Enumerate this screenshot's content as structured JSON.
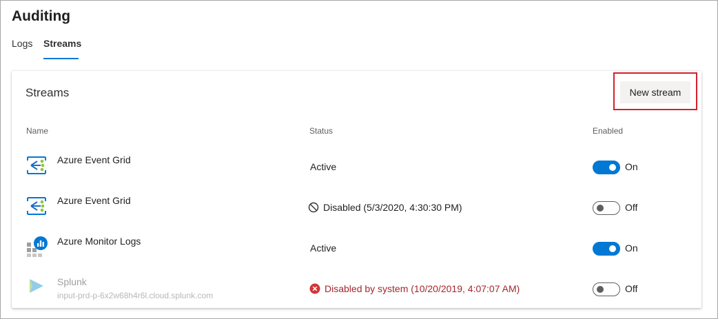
{
  "page": {
    "title": "Auditing"
  },
  "tabs": [
    {
      "label": "Logs",
      "selected": false
    },
    {
      "label": "Streams",
      "selected": true
    }
  ],
  "card": {
    "title": "Streams",
    "new_stream_label": "New stream"
  },
  "columns": {
    "name": "Name",
    "status": "Status",
    "enabled": "Enabled"
  },
  "rows": [
    {
      "icon": "event-grid-icon",
      "name": "Azure Event Grid",
      "subtitle": "",
      "status": "Active",
      "status_icon": "",
      "enabled": true,
      "toggle_label": "On"
    },
    {
      "icon": "event-grid-icon",
      "name": "Azure Event Grid",
      "subtitle": "",
      "status": "Disabled (5/3/2020, 4:30:30 PM)",
      "status_icon": "blocked-icon",
      "enabled": false,
      "toggle_label": "Off"
    },
    {
      "icon": "monitor-logs-icon",
      "name": "Azure Monitor Logs",
      "subtitle": "",
      "status": "Active",
      "status_icon": "",
      "enabled": true,
      "toggle_label": "On"
    },
    {
      "icon": "splunk-icon",
      "name": "Splunk",
      "subtitle": "input-prd-p-6x2w68h4r6l.cloud.splunk.com",
      "status": "Disabled by system (10/20/2019, 4:07:07 AM)",
      "status_icon": "error-icon",
      "enabled": false,
      "toggle_label": "Off"
    }
  ],
  "colors": {
    "accent": "#0078d4",
    "error": "#a4262c",
    "highlight": "#d4202a"
  }
}
